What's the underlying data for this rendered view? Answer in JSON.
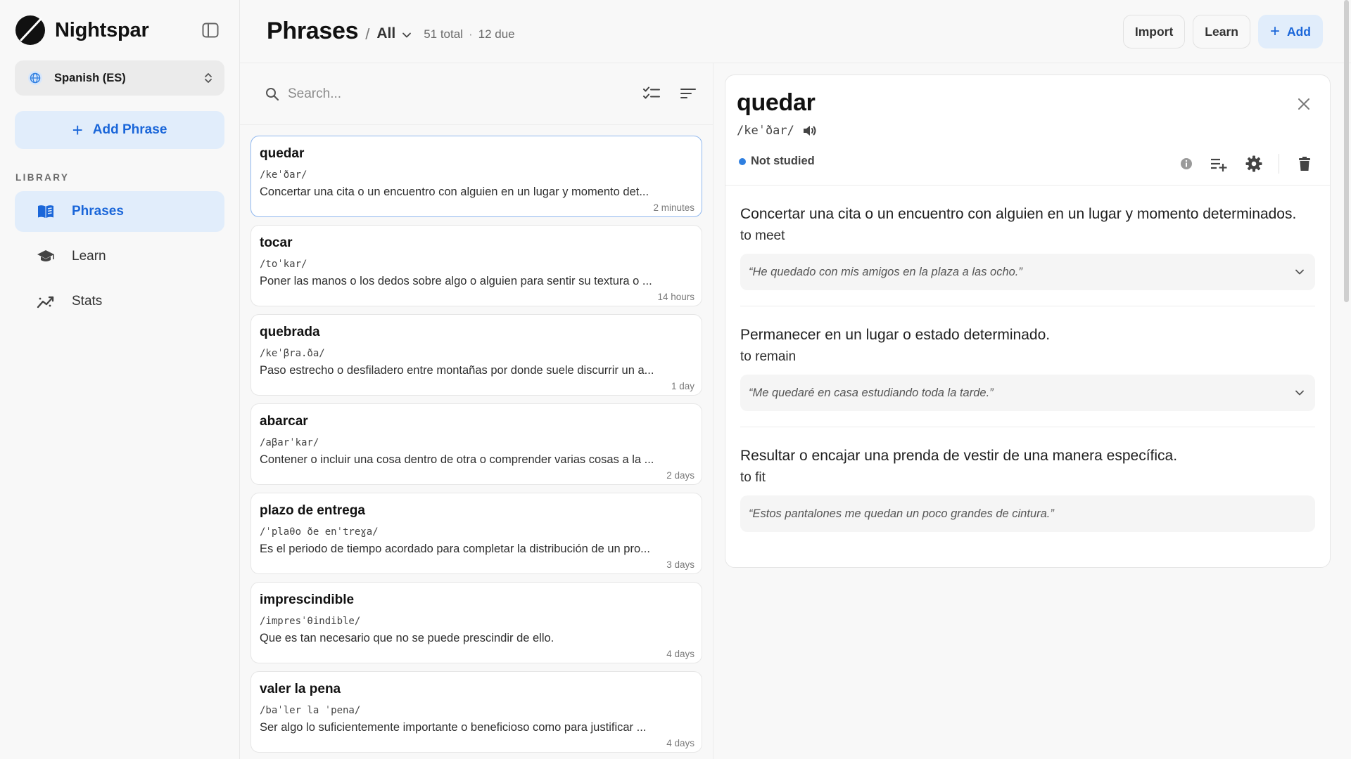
{
  "app": {
    "name": "Nightspar",
    "accent": "#1a66d9",
    "accent_bg": "#e1edfb"
  },
  "sidebar": {
    "language": "Spanish (ES)",
    "add_phrase_label": "Add Phrase",
    "library_heading": "LIBRARY",
    "items": [
      {
        "label": "Phrases",
        "icon": "book-icon",
        "active": true
      },
      {
        "label": "Learn",
        "icon": "graduation-cap-icon",
        "active": false
      },
      {
        "label": "Stats",
        "icon": "trend-icon",
        "active": false
      }
    ]
  },
  "header": {
    "title": "Phrases",
    "separator": "/",
    "filter": "All",
    "total": "51 total",
    "dot": "·",
    "due": "12 due",
    "import_label": "Import",
    "learn_label": "Learn",
    "add_label": "Add"
  },
  "search": {
    "placeholder": "Search..."
  },
  "phrases": [
    {
      "title": "quedar",
      "ipa": "/keˈðar/",
      "definition": "Concertar una cita o un encuentro con alguien en un lugar y momento det...",
      "time": "2 minutes"
    },
    {
      "title": "tocar",
      "ipa": "/toˈkar/",
      "definition": "Poner las manos o los dedos sobre algo o alguien para sentir su textura o ...",
      "time": "14 hours"
    },
    {
      "title": "quebrada",
      "ipa": "/keˈβra.ða/",
      "definition": "Paso estrecho o desfiladero entre montañas por donde suele discurrir un a...",
      "time": "1 day"
    },
    {
      "title": "abarcar",
      "ipa": "/aβarˈkar/",
      "definition": "Contener o incluir una cosa dentro de otra o comprender varias cosas a la ...",
      "time": "2 days"
    },
    {
      "title": "plazo de entrega",
      "ipa": "/ˈplaθo ðe enˈtreɣa/",
      "definition": "Es el periodo de tiempo acordado para completar la distribución de un pro...",
      "time": "3 days"
    },
    {
      "title": "imprescindible",
      "ipa": "/impresˈθindible/",
      "definition": "Que es tan necesario que no se puede prescindir de ello.",
      "time": "4 days"
    },
    {
      "title": "valer la pena",
      "ipa": "/baˈler la ˈpena/",
      "definition": "Ser algo lo suficientemente importante o beneficioso como para justificar ...",
      "time": "4 days"
    }
  ],
  "detail": {
    "word": "quedar",
    "ipa": "/keˈðar/",
    "status": "Not studied",
    "status_color": "#2f7fe0",
    "senses": [
      {
        "definition": "Concertar una cita o un encuentro con alguien en un lugar y momento determinados.",
        "translation": "to meet",
        "example": "“He quedado con mis amigos en la plaza a las ocho.”",
        "expandable": true
      },
      {
        "definition": "Permanecer en un lugar o estado determinado.",
        "translation": "to remain",
        "example": "“Me quedaré en casa estudiando toda la tarde.”",
        "expandable": true
      },
      {
        "definition": "Resultar o encajar una prenda de vestir de una manera específica.",
        "translation": "to fit",
        "example": "“Estos pantalones me quedan un poco grandes de cintura.”",
        "expandable": false
      }
    ]
  }
}
